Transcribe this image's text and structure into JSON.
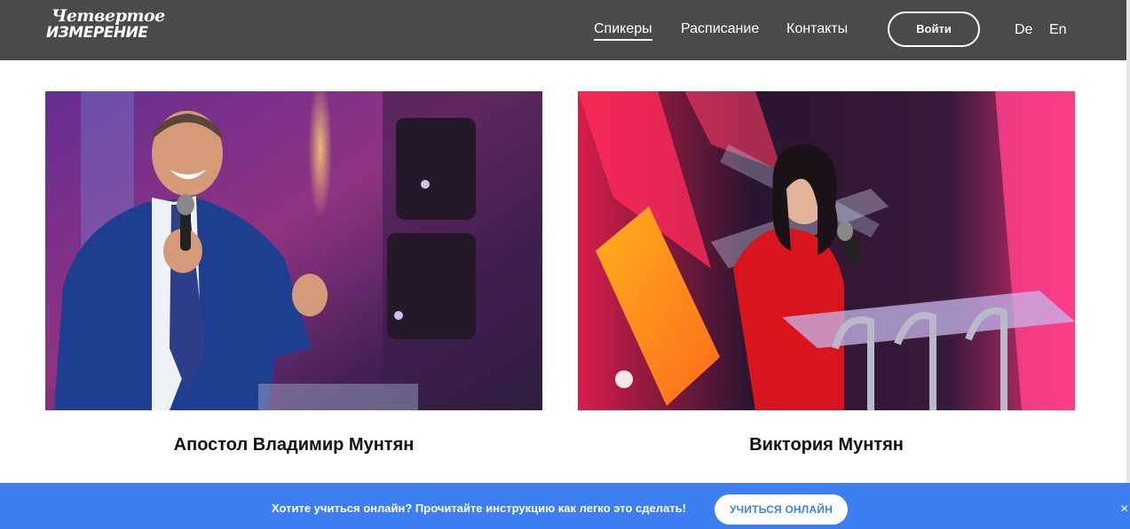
{
  "header": {
    "logo": {
      "line1": "Четвертое",
      "line2": "ИЗМЕРЕНИЕ"
    },
    "nav": [
      {
        "label": "Спикеры",
        "active": true
      },
      {
        "label": "Расписание",
        "active": false
      },
      {
        "label": "Контакты",
        "active": false
      }
    ],
    "login_label": "Войти",
    "languages": [
      "De",
      "En"
    ]
  },
  "speakers": [
    {
      "name": "Апостол Владимир Мунтян"
    },
    {
      "name": "Виктория Мунтян"
    }
  ],
  "banner": {
    "text": "Хотите учиться онлайн? Прочитайте инструкцию как легко это сделать!",
    "button_label": "УЧИТЬСЯ ОНЛАЙН",
    "close_icon": "×"
  },
  "colors": {
    "header_bg": "#4a4a4a",
    "banner_bg": "#3d7ff2",
    "text_dark": "#111111"
  }
}
